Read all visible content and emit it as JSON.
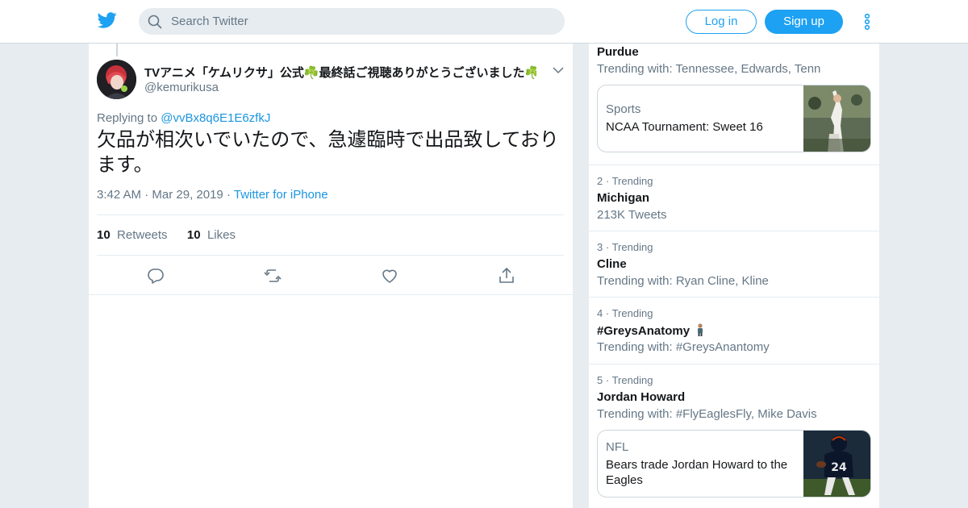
{
  "header": {
    "logo": "twitter-bird-icon",
    "search_placeholder": "Search Twitter",
    "login_label": "Log in",
    "signup_label": "Sign up",
    "more": "more-vertical-icon"
  },
  "tweet": {
    "author_name": "TVアニメ「ケムリクサ」公式☘️最終話ご視聴ありがとうございました☘️",
    "author_handle": "@kemurikusa",
    "replying_prefix": "Replying to",
    "replying_to": "@vvBx8q6E1E6zfkJ",
    "text": "欠品が相次いでいたので、急遽臨時で出品致しております。",
    "time": "3:42 AM",
    "date": "Mar 29, 2019",
    "sep": "·",
    "source": "Twitter for iPhone",
    "retweets_count": "10",
    "retweets_label": "Retweets",
    "likes_count": "10",
    "likes_label": "Likes"
  },
  "trends": [
    {
      "name": "Purdue",
      "sub": "Trending with: Tennessee, Edwards, Tenn",
      "card": {
        "category": "Sports",
        "title": "NCAA Tournament: Sweet 16"
      }
    },
    {
      "rank": "2",
      "label": "Trending",
      "sep": "·",
      "name": "Michigan",
      "sub": "213K Tweets"
    },
    {
      "rank": "3",
      "label": "Trending",
      "sep": "·",
      "name": "Cline",
      "sub": "Trending with: Ryan Cline, Kline"
    },
    {
      "rank": "4",
      "label": "Trending",
      "sep": "·",
      "name": "#GreysAnatomy",
      "sub": "Trending with: #GreysAnantomy"
    },
    {
      "rank": "5",
      "label": "Trending",
      "sep": "·",
      "name": "Jordan Howard",
      "sub": "Trending with: #FlyEaglesFly, Mike Davis",
      "card": {
        "category": "NFL",
        "title": "Bears trade Jordan Howard to the Eagles"
      }
    }
  ],
  "colors": {
    "accent": "#1da1f2",
    "link": "#1b95e0",
    "muted": "#657786",
    "background": "#e6ecf0"
  }
}
